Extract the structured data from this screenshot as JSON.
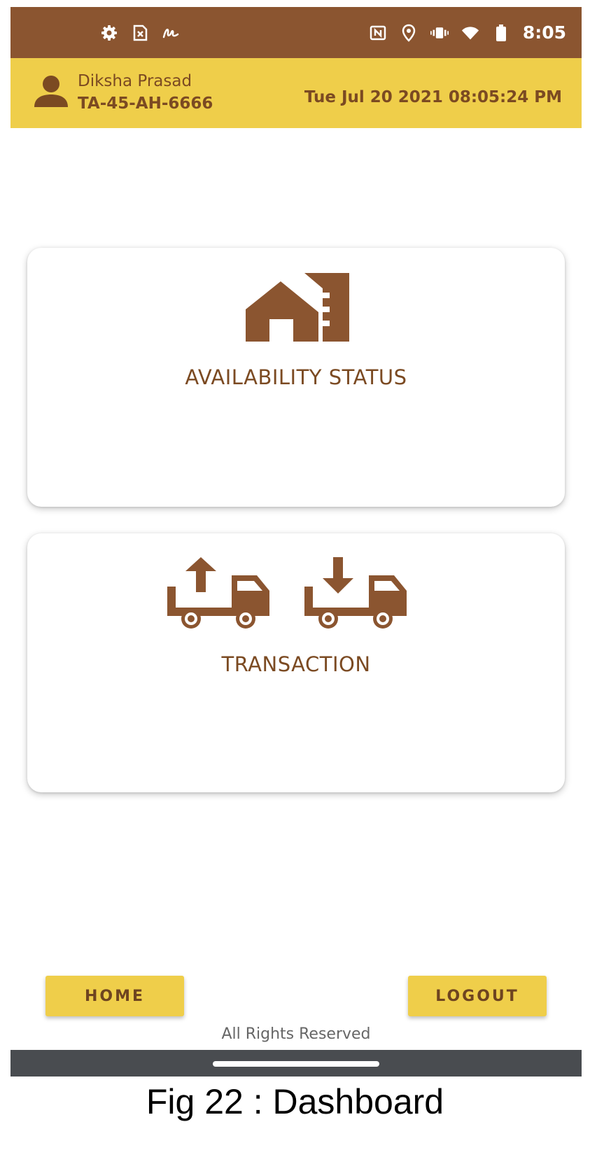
{
  "status_bar": {
    "time": "8:05",
    "left_icons": [
      "gear-icon",
      "sim-error-icon",
      "signature-icon"
    ],
    "right_icons": [
      "nfc-icon",
      "location-icon",
      "vibrate-icon",
      "wifi-icon",
      "battery-icon"
    ]
  },
  "header": {
    "user_name": "Diksha Prasad",
    "vehicle_id": "TA-45-AH-6666",
    "datetime": "Tue Jul 20 2021 08:05:24 PM"
  },
  "cards": {
    "availability": {
      "label": "AVAILABILITY STATUS",
      "icon": "warehouse-icon"
    },
    "transaction": {
      "label": "TRANSACTION",
      "icons": [
        "truck-load-icon",
        "truck-unload-icon"
      ]
    }
  },
  "buttons": {
    "home": "HOME",
    "logout": "LOGOUT"
  },
  "footer": {
    "text": "All Rights Reserved"
  },
  "caption": "Fig 22 : Dashboard",
  "colors": {
    "brown": "#8B5530",
    "yellow": "#EFCE4A",
    "text_brown": "#7B4A22",
    "nav_gray": "#494C50"
  }
}
